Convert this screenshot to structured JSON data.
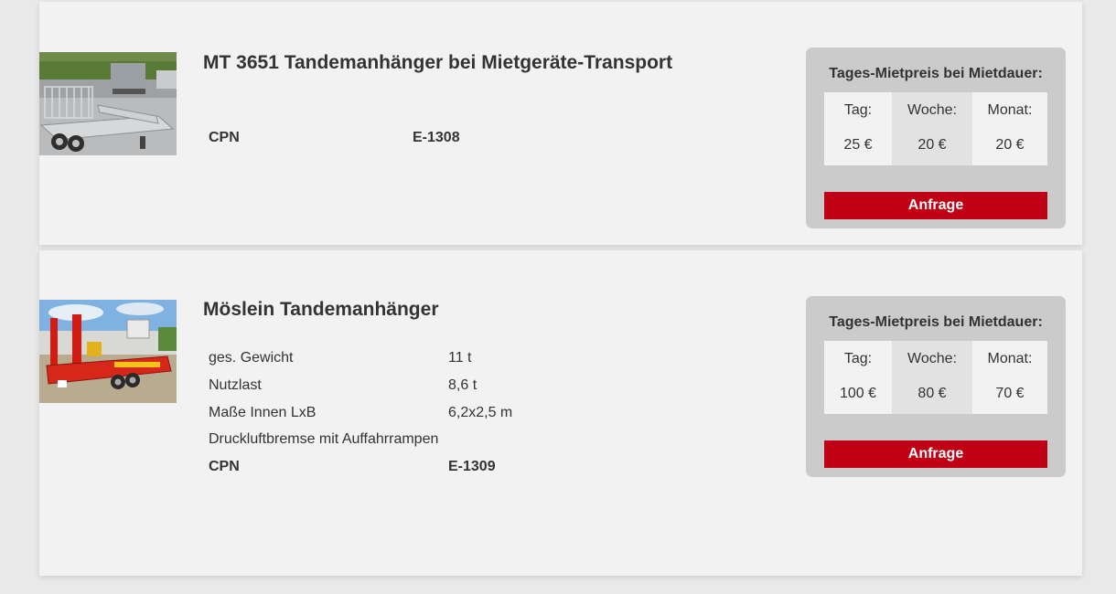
{
  "listings": [
    {
      "title": "MT 3651 Tandemanhänger bei Mietgeräte-Transport",
      "image_alt": "trailer-photo",
      "specs": [
        {
          "key": "CPN",
          "value": "E-1308",
          "bold": true
        }
      ],
      "price": {
        "heading": "Tages-Mietpreis bei Mietdauer:",
        "columns": [
          {
            "label": "Tag:",
            "value": "25 €"
          },
          {
            "label": "Woche:",
            "value": "20 €"
          },
          {
            "label": "Monat:",
            "value": "20 €"
          }
        ],
        "button": "Anfrage"
      }
    },
    {
      "title": "Möslein Tandemanhänger",
      "image_alt": "trailer-photo",
      "specs": [
        {
          "key": "ges. Gewicht",
          "value": "11 t",
          "bold": false
        },
        {
          "key": "Nutzlast",
          "value": "8,6 t",
          "bold": false
        },
        {
          "key": "Maße Innen LxB",
          "value": "6,2x2,5 m",
          "bold": false
        },
        {
          "key": "Druckluftbremse mit Auffahrrampen",
          "value": "",
          "bold": false
        },
        {
          "key": "CPN",
          "value": "E-1309",
          "bold": true
        }
      ],
      "price": {
        "heading": "Tages-Mietpreis bei Mietdauer:",
        "columns": [
          {
            "label": "Tag:",
            "value": "100 €"
          },
          {
            "label": "Woche:",
            "value": "80 €"
          },
          {
            "label": "Monat:",
            "value": "70 €"
          }
        ],
        "button": "Anfrage"
      }
    }
  ],
  "colors": {
    "accent": "#c00015",
    "card_bg": "#f2f2f2",
    "pricebox_bg": "#cbcbcb"
  }
}
